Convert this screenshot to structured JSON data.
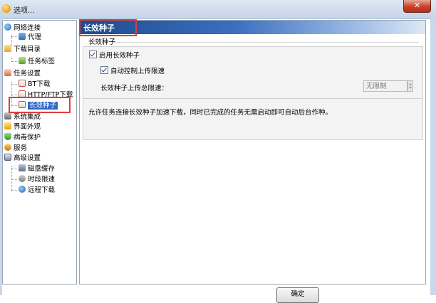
{
  "window": {
    "title": "选项...",
    "close_glyph": "✕"
  },
  "tree": {
    "items": [
      {
        "label": "网络连接",
        "icon": "globe-icon",
        "level": 0
      },
      {
        "label": "代理",
        "icon": "proxy-icon",
        "level": 1
      },
      {
        "label": "下载目录",
        "icon": "folder-icon",
        "level": 0
      },
      {
        "label": "任务标签",
        "icon": "tag-icon",
        "level": 1
      },
      {
        "label": "任务设置",
        "icon": "task-icon",
        "level": 0
      },
      {
        "label": "BT下载",
        "icon": "bt-icon",
        "level": 1
      },
      {
        "label": "HTTP/FTP下载",
        "icon": "http-icon",
        "level": 1
      },
      {
        "label": "长效种子",
        "icon": "seed-icon",
        "level": 1,
        "selected": true
      },
      {
        "label": "系统集成",
        "icon": "system-icon",
        "level": 0
      },
      {
        "label": "界面外观",
        "icon": "appearance-icon",
        "level": 0
      },
      {
        "label": "病毒保护",
        "icon": "shield-icon",
        "level": 0
      },
      {
        "label": "服务",
        "icon": "service-icon",
        "level": 0
      },
      {
        "label": "高级设置",
        "icon": "advanced-icon",
        "level": 0
      },
      {
        "label": "磁盘缓存",
        "icon": "disk-icon",
        "level": 1
      },
      {
        "label": "时段限速",
        "icon": "clock-icon",
        "level": 1
      },
      {
        "label": "远程下载",
        "icon": "remote-icon",
        "level": 1
      }
    ]
  },
  "panel": {
    "header_title": "长效种子",
    "group_label": "长效种子",
    "enable_label": "启用长效种子",
    "enable_checked": true,
    "auto_label": "自动控制上传限速",
    "auto_checked": true,
    "total_limit_label": "长效种子上传总限速：",
    "total_limit_value": "无限制",
    "description": "允许任务连接长效种子加速下载，同时已完成的任务无需启动即可自动后台作种。"
  },
  "footer": {
    "ok_label": "确定"
  },
  "colors": {
    "annotation": "#e23b3b",
    "selected_bg": "#3168c8",
    "header_dark": "#1f4a8c"
  }
}
